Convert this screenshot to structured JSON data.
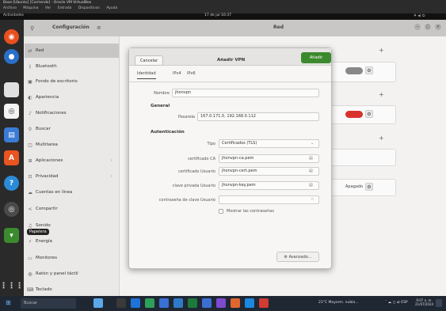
{
  "host": {
    "title": "Base [Ubuntu] [Corriendo] - Oracle VM VirtualBox",
    "menu": [
      "Archivo",
      "Máquina",
      "Ver",
      "Entrada",
      "Dispositivos",
      "Ayuda"
    ]
  },
  "topbar": {
    "activities": "Actividades",
    "clock": "17 de jul 10:37",
    "tray": "⚘ ◂) ⏻"
  },
  "settings": {
    "title": "Configuración",
    "page_title": "Red",
    "sidebar": [
      {
        "label": "Red",
        "icon": "network-icon",
        "active": true
      },
      {
        "label": "Bluetooth",
        "icon": "bluetooth-icon"
      },
      {
        "label": "Fondo de escritorio",
        "icon": "wallpaper-icon"
      },
      {
        "label": "Apariencia",
        "icon": "appearance-icon"
      },
      {
        "label": "Notificaciones",
        "icon": "bell-icon"
      },
      {
        "label": "Buscar",
        "icon": "search-icon"
      },
      {
        "label": "Multitarea",
        "icon": "multitask-icon"
      },
      {
        "label": "Aplicaciones",
        "icon": "apps-icon",
        "chevron": true
      },
      {
        "label": "Privacidad",
        "icon": "lock-icon",
        "chevron": true
      },
      {
        "label": "Cuentas en línea",
        "icon": "cloud-icon"
      },
      {
        "label": "Compartir",
        "icon": "share-icon"
      },
      {
        "label": "Sonido",
        "icon": "sound-icon"
      },
      {
        "label": "Energía",
        "icon": "power-icon"
      },
      {
        "label": "Monitores",
        "icon": "monitor-icon"
      },
      {
        "label": "Ratón y panel táctil",
        "icon": "mouse-icon"
      },
      {
        "label": "Teclado",
        "icon": "keyboard-icon"
      }
    ],
    "proxy_status": "Apagado"
  },
  "tooltip": "Papelera",
  "dialog": {
    "cancel": "Cancelar",
    "title": "Añadir VPN",
    "add": "Añadir",
    "tabs": [
      "Identidad",
      "IPv4",
      "IPv6"
    ],
    "name_label": "Nombre",
    "name_value": "jhonvpn",
    "general": "General",
    "gateway_label": "Pasarela",
    "gateway_value": "167.0.171.0, 192.168.0.112",
    "auth": "Autenticación",
    "type_label": "Tipo",
    "type_value": "Certificados (TLS)",
    "ca_label": "certificado CA",
    "ca_value": "jhonvpn-ca.pem",
    "user_cert_label": "certificado Usuario",
    "user_cert_value": "jhonvpn-cert.pem",
    "key_label": "clave privada Usuario",
    "key_value": "jhonvpn-key.pem",
    "pass_label": "contraseña de clave Usuario",
    "show_pass": "Mostrar las contraseñas",
    "advanced": "⚙ Avanzado..."
  },
  "taskbar": {
    "search": "Buscar",
    "weather": "21°C Mayorm. nubla...",
    "tray": "ˆ ☁ ◻ ◂) ESP",
    "time": "9:07 a. m.",
    "date": "21/07/2024"
  },
  "colors": {
    "accent_green": "#3c8a2e",
    "toggle_red": "#d9322b",
    "dock_bg": "#2a2a2a"
  }
}
